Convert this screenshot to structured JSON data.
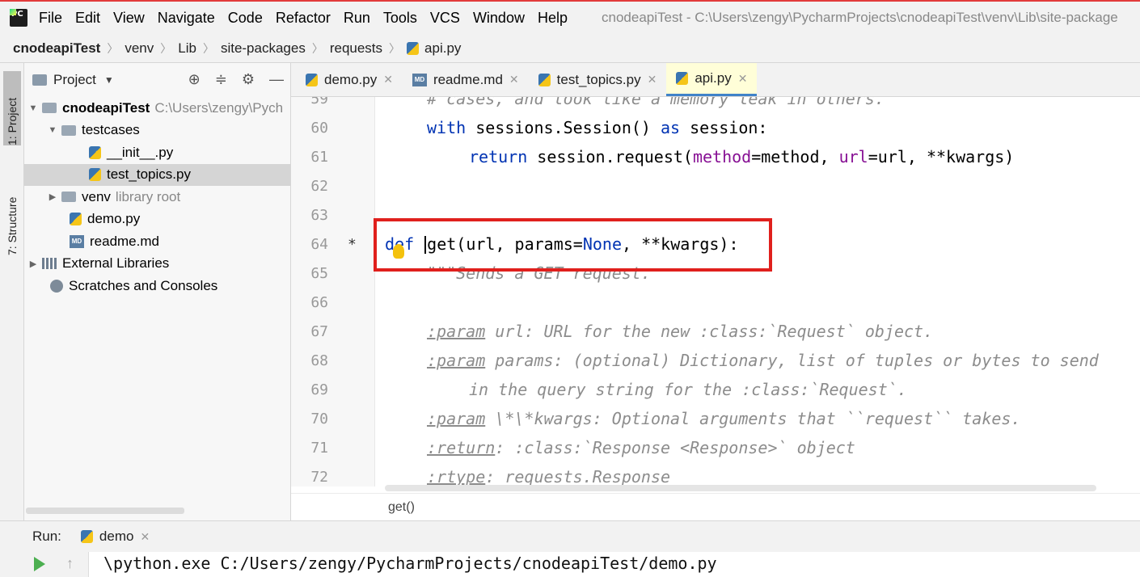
{
  "menubar": {
    "items": [
      "File",
      "Edit",
      "View",
      "Navigate",
      "Code",
      "Refactor",
      "Run",
      "Tools",
      "VCS",
      "Window",
      "Help"
    ],
    "window_title": "cnodeapiTest - C:\\Users\\zengy\\PycharmProjects\\cnodeapiTest\\venv\\Lib\\site-package"
  },
  "breadcrumb": {
    "items": [
      "cnodeapiTest",
      "venv",
      "Lib",
      "site-packages",
      "requests",
      "api.py"
    ]
  },
  "tool_stripe": {
    "project_tab": "1: Project",
    "structure_tab": "7: Structure"
  },
  "project_panel": {
    "title": "Project",
    "tree": [
      {
        "label": "cnodeapiTest",
        "extra": "C:\\Users\\zengy\\Pych"
      },
      {
        "label": "testcases"
      },
      {
        "label": "__init__.py"
      },
      {
        "label": "test_topics.py"
      },
      {
        "label": "venv",
        "extra": "library root"
      },
      {
        "label": "demo.py"
      },
      {
        "label": "readme.md"
      },
      {
        "label": "External Libraries"
      },
      {
        "label": "Scratches and Consoles"
      }
    ]
  },
  "editor": {
    "tabs": [
      "demo.py",
      "readme.md",
      "test_topics.py",
      "api.py"
    ],
    "active_tab": "api.py",
    "footer_context": "get()",
    "lines": [
      {
        "n": "59",
        "text": "# cases, and look like a memory leak in others."
      },
      {
        "n": "60"
      },
      {
        "n": "61"
      },
      {
        "n": "62"
      },
      {
        "n": "63"
      },
      {
        "n": "64",
        "marker": "*"
      },
      {
        "n": "65",
        "text": "\"\"\"Sends a GET request."
      },
      {
        "n": "66"
      },
      {
        "n": "67",
        "tag": ":param",
        "text": " url: URL for the new :class:`Request` object."
      },
      {
        "n": "68",
        "tag": ":param",
        "text": " params: (optional) Dictionary, list of tuples or bytes to send"
      },
      {
        "n": "69",
        "text": "in the query string for the :class:`Request`."
      },
      {
        "n": "70",
        "tag": ":param",
        "text": " \\*\\*kwargs: Optional arguments that ``request`` takes."
      },
      {
        "n": "71",
        "tag": ":return",
        "text": ": :class:`Response <Response>` object"
      },
      {
        "n": "72",
        "tag": ":rtype",
        "text": ": requests.Response"
      }
    ],
    "code60": {
      "kw1": "with",
      "mid": " sessions.Session() ",
      "kw2": "as",
      "end": " session:"
    },
    "code61": {
      "kw": "return",
      "a": " session.request(",
      "p1": "method",
      "b": "=method, ",
      "p2": "url",
      "c": "=url, **kwargs)"
    },
    "code64": {
      "kw": "def",
      "fn": "get",
      "a": "(url, params=",
      "none": "None",
      "b": ", **kwargs):"
    }
  },
  "run_panel": {
    "label": "Run:",
    "tab": "demo",
    "console": "\\python.exe C:/Users/zengy/PycharmProjects/cnodeapiTest/demo.py"
  },
  "colors": {
    "keyword": "#0033b3",
    "named_param": "#871094",
    "docstring": "#8c8c8c",
    "highlight_box": "#e0201d",
    "active_tab": "#fffed8"
  }
}
